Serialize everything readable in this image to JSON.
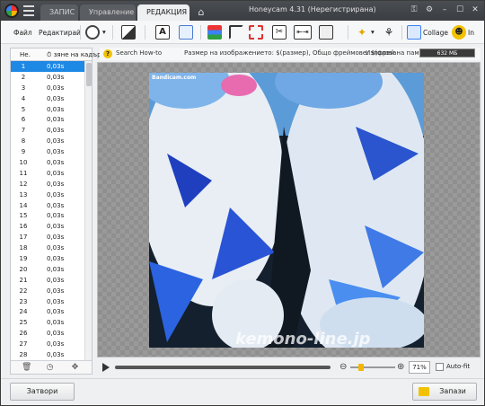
{
  "app": {
    "title": "Honeycam 4.31 (Нерегистрирана)",
    "tabs": [
      {
        "label": "ЗАПИС"
      },
      {
        "label": "Управление"
      },
      {
        "label": "РЕДАКЦИЯ"
      }
    ]
  },
  "toolbar": {
    "file_label": "Файл",
    "edit_label": "Редактирай",
    "collage_label": "Collage",
    "in_label": "In"
  },
  "frames_panel": {
    "col_num": "Не.",
    "col_delay": "зяне на кадър",
    "rows": [
      {
        "num": "1",
        "delay": "0,03s"
      },
      {
        "num": "2",
        "delay": "0,03s"
      },
      {
        "num": "3",
        "delay": "0,03s"
      },
      {
        "num": "4",
        "delay": "0,03s"
      },
      {
        "num": "5",
        "delay": "0,03s"
      },
      {
        "num": "6",
        "delay": "0,03s"
      },
      {
        "num": "7",
        "delay": "0,03s"
      },
      {
        "num": "8",
        "delay": "0,03s"
      },
      {
        "num": "9",
        "delay": "0,03s"
      },
      {
        "num": "10",
        "delay": "0,03s"
      },
      {
        "num": "11",
        "delay": "0,03s"
      },
      {
        "num": "12",
        "delay": "0,03s"
      },
      {
        "num": "13",
        "delay": "0,03s"
      },
      {
        "num": "14",
        "delay": "0,03s"
      },
      {
        "num": "15",
        "delay": "0,03s"
      },
      {
        "num": "16",
        "delay": "0,03s"
      },
      {
        "num": "17",
        "delay": "0,03s"
      },
      {
        "num": "18",
        "delay": "0,03s"
      },
      {
        "num": "19",
        "delay": "0,03s"
      },
      {
        "num": "20",
        "delay": "0,03s"
      },
      {
        "num": "21",
        "delay": "0,03s"
      },
      {
        "num": "22",
        "delay": "0,03s"
      },
      {
        "num": "23",
        "delay": "0,03s"
      },
      {
        "num": "24",
        "delay": "0,03s"
      },
      {
        "num": "25",
        "delay": "0,03s"
      },
      {
        "num": "26",
        "delay": "0,03s"
      },
      {
        "num": "27",
        "delay": "0,03s"
      },
      {
        "num": "28",
        "delay": "0,03s"
      }
    ]
  },
  "infobar": {
    "search_label": "Search How-to",
    "size_text": "Размер на изображението: $(размер), Общо фреймове: $(фрей",
    "memory_label": "Използвана памет:",
    "memory_value": "632 МБ"
  },
  "canvas": {
    "watermark_top": "Bandicam.com",
    "watermark_bottom": "kemono-line.jp"
  },
  "playback": {
    "zoom": "71%",
    "autofit_label": "Auto-fit"
  },
  "buttons": {
    "close_label": "Затвори",
    "save_label": "Запази"
  },
  "colors": {
    "selected_row": "#1e88e5",
    "accent": "#f2c200",
    "titlebar": "#3a3d42"
  }
}
